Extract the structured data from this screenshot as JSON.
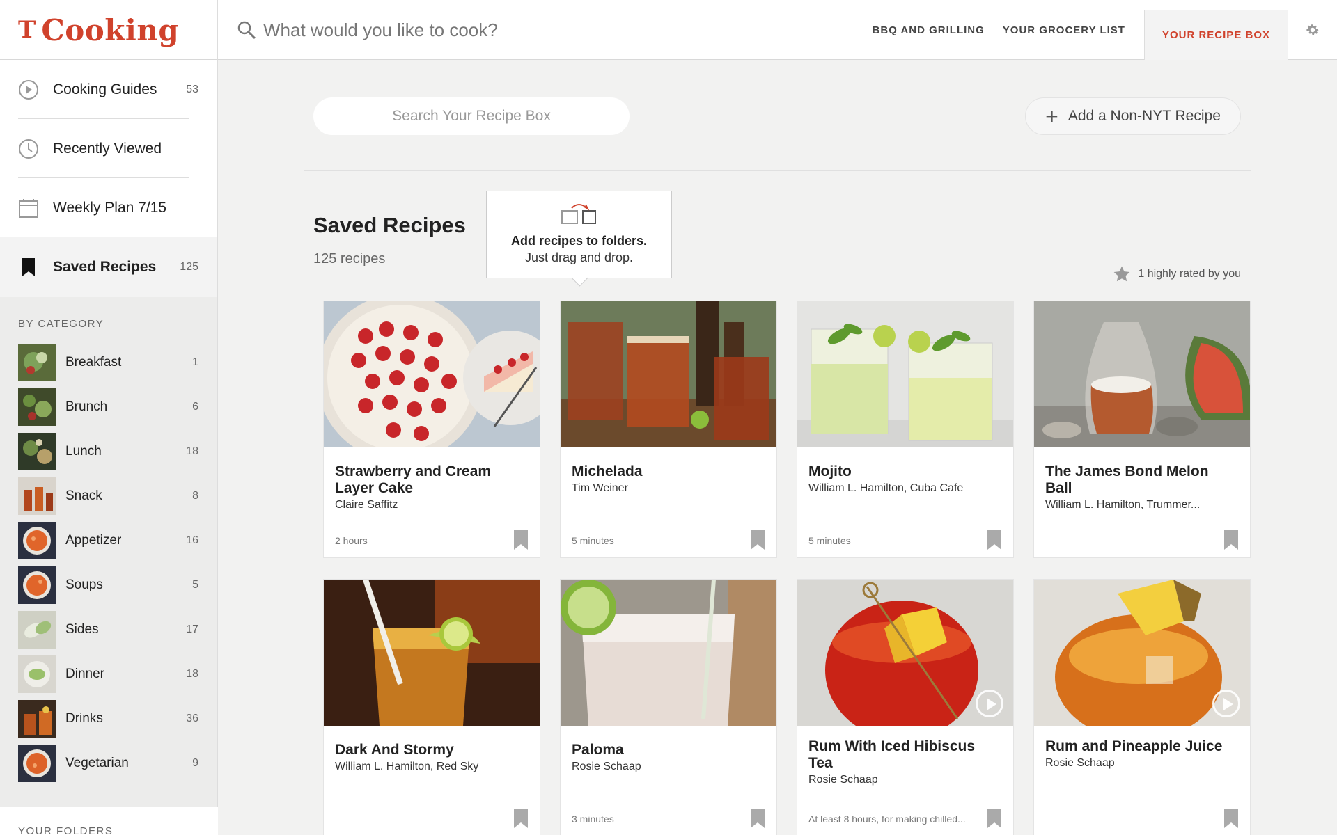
{
  "header": {
    "brand_mark": "T",
    "brand_name": "Cooking",
    "search_placeholder": "What would you like to cook?",
    "nav": [
      "BBQ AND GRILLING",
      "YOUR GROCERY LIST"
    ],
    "nav_active": "YOUR RECIPE BOX",
    "brand_color": "#d0422c"
  },
  "sidebar": {
    "items": [
      {
        "label": "Cooking Guides",
        "count": "53",
        "icon": "play-circle-icon"
      },
      {
        "label": "Recently Viewed",
        "count": "",
        "icon": "clock-icon"
      },
      {
        "label": "Weekly Plan 7/15",
        "count": "",
        "icon": "calendar-icon"
      },
      {
        "label": "Saved Recipes",
        "count": "125",
        "icon": "bookmark-icon"
      }
    ],
    "category_header": "BY CATEGORY",
    "categories": [
      {
        "label": "Breakfast",
        "count": "1"
      },
      {
        "label": "Brunch",
        "count": "6"
      },
      {
        "label": "Lunch",
        "count": "18"
      },
      {
        "label": "Snack",
        "count": "8"
      },
      {
        "label": "Appetizer",
        "count": "16"
      },
      {
        "label": "Soups",
        "count": "5"
      },
      {
        "label": "Sides",
        "count": "17"
      },
      {
        "label": "Dinner",
        "count": "18"
      },
      {
        "label": "Drinks",
        "count": "36"
      },
      {
        "label": "Vegetarian",
        "count": "9"
      }
    ],
    "folders_header": "YOUR FOLDERS"
  },
  "main": {
    "search_placeholder": "Search Your Recipe Box",
    "add_button": "Add a Non-NYT Recipe",
    "title": "Saved Recipes",
    "count": "125 recipes",
    "tooltip_line1": "Add recipes to folders.",
    "tooltip_line2": "Just drag and drop.",
    "rated_text": "1 highly rated by you",
    "recipes": [
      {
        "title": "Strawberry and Cream Layer Cake",
        "author": "Claire Saffitz",
        "time": "2 hours"
      },
      {
        "title": "Michelada",
        "author": "Tim Weiner",
        "time": "5 minutes"
      },
      {
        "title": "Mojito",
        "author": "William L. Hamilton, Cuba Cafe",
        "time": "5 minutes"
      },
      {
        "title": "The James Bond Melon Ball",
        "author": "William L. Hamilton, Trummer...",
        "time": ""
      },
      {
        "title": "Dark And Stormy",
        "author": "William L. Hamilton, Red Sky",
        "time": ""
      },
      {
        "title": "Paloma",
        "author": "Rosie Schaap",
        "time": "3 minutes"
      },
      {
        "title": "Rum With Iced Hibiscus Tea",
        "author": "Rosie Schaap",
        "time": "At least 8 hours, for making chilled..."
      },
      {
        "title": "Rum and Pineapple Juice",
        "author": "Rosie Schaap",
        "time": ""
      }
    ]
  }
}
